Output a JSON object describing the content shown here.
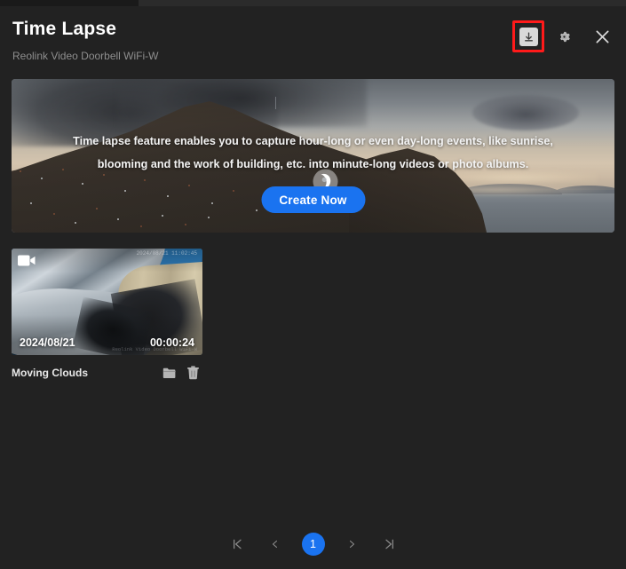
{
  "window": {
    "cutoff_titlebar_text": "· · ·· ···· ···"
  },
  "header": {
    "title": "Time Lapse",
    "subtitle": "Reolink Video Doorbell WiFi-W",
    "actions": [
      {
        "name": "download-icon",
        "label": "Download",
        "highlighted": true,
        "highlight_color": "#ff1a1a"
      },
      {
        "name": "gear-icon",
        "label": "Settings",
        "highlighted": false
      },
      {
        "name": "close-icon",
        "label": "Close",
        "highlighted": false
      }
    ]
  },
  "banner": {
    "description": "Time lapse feature enables you to capture hour-long or even day-long events, like sunrise, blooming and the work of building, etc. into minute-long videos or photo albums.",
    "create_button_label": "Create Now",
    "watermark": "reolink-logo-watermark",
    "accent_color": "#1a73f0"
  },
  "videos": [
    {
      "name": "Moving Clouds",
      "date": "2024/08/21",
      "duration": "00:00:24",
      "osd_top": "2024/08/21 11:02:45",
      "osd_bottom": "Reolink Video Doorbell WiFi-W",
      "badge": "video-camera-icon",
      "actions": [
        {
          "name": "folder-icon",
          "label": "Open folder"
        },
        {
          "name": "trash-icon",
          "label": "Delete"
        }
      ]
    }
  ],
  "pagination": {
    "first_label": "First page",
    "prev_label": "Previous page",
    "current_page": "1",
    "next_label": "Next page",
    "last_label": "Last page",
    "active_color": "#1a73f0"
  }
}
